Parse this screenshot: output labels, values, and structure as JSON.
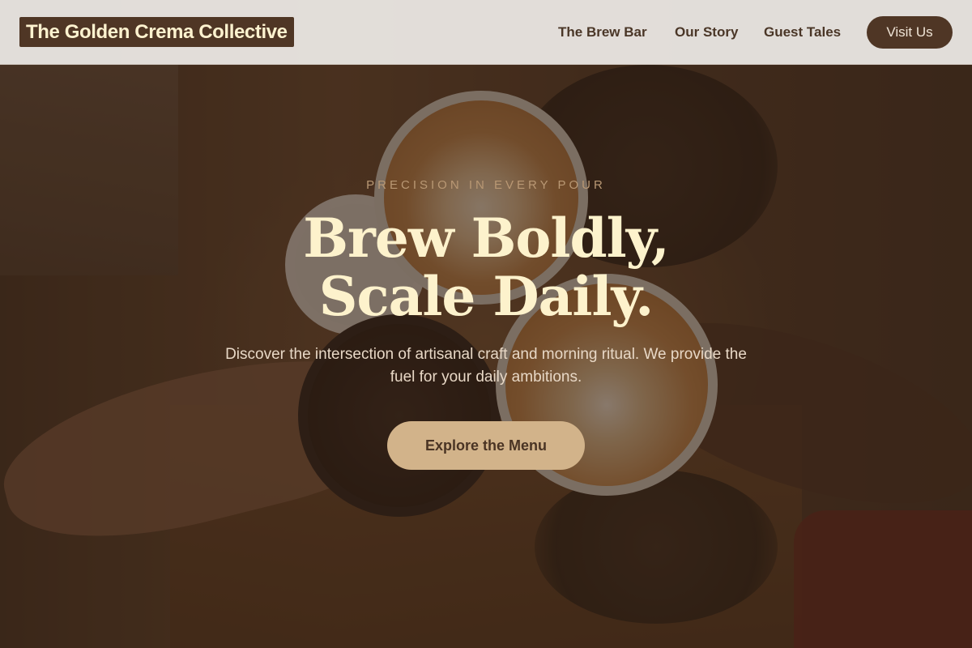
{
  "header": {
    "brand": "The Golden Crema Collective",
    "nav": [
      {
        "label": "The Brew Bar"
      },
      {
        "label": "Our Story"
      },
      {
        "label": "Guest Tales"
      }
    ],
    "cta_label": "Visit Us"
  },
  "hero": {
    "eyebrow": "PRECISION IN EVERY POUR",
    "headline_line1": "Brew Boldly,",
    "headline_line2": "Scale Daily.",
    "subtext": "Discover the intersection of artisanal craft and morning ritual. We provide the fuel for your daily ambitions.",
    "cta_label": "Explore the Menu",
    "background_image": "coffee-cups-toast-photo"
  },
  "colors": {
    "brand_bg": "#4f3625",
    "brand_text": "#fdf2cf",
    "header_bg": "#ece9e5",
    "nav_text": "#4a3627",
    "headline": "#fdf2cc",
    "eyebrow": "#b99874",
    "cta_bg": "#d2b38a",
    "cta_text": "#4a3424"
  }
}
